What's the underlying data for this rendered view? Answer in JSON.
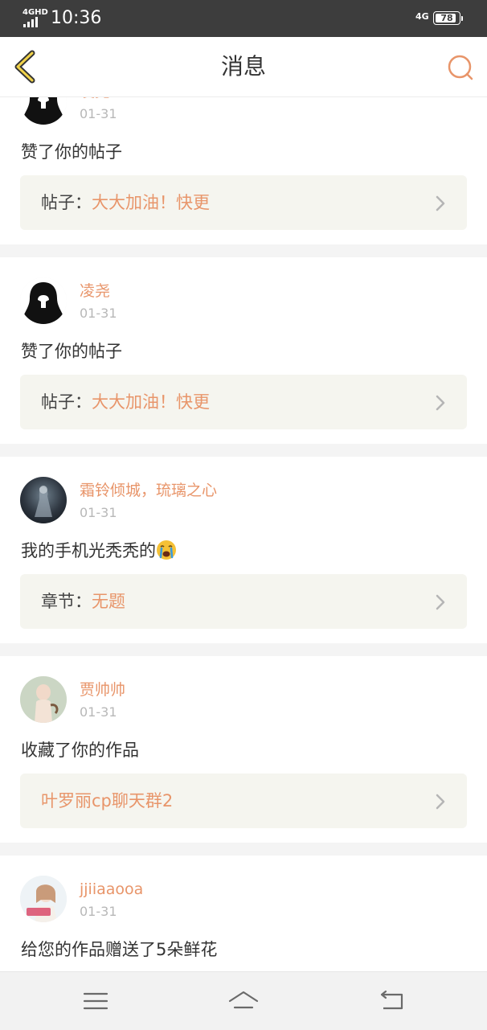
{
  "status_bar": {
    "network_label": "4GHD",
    "time": "10:36",
    "network_right": "4G",
    "battery_level": "78"
  },
  "header": {
    "title": "消息",
    "back_icon": "chevron-left-icon",
    "search_icon": "search-icon",
    "accent_color": "#e8956a"
  },
  "messages": [
    {
      "username": "凌尧",
      "date": "01-31",
      "action": "赞了你的帖子",
      "ref_prefix": "帖子：",
      "ref_title": "大大加油！快更"
    },
    {
      "username": "凌尧",
      "date": "01-31",
      "action": "赞了你的帖子",
      "ref_prefix": "帖子：",
      "ref_title": "大大加油！快更"
    },
    {
      "username": "霜铃倾城，琉璃之心",
      "date": "01-31",
      "action": "我的手机光秃秃的",
      "action_emoji": "crying-face-icon",
      "ref_prefix": "章节：",
      "ref_title": "无题"
    },
    {
      "username": "贾帅帅",
      "date": "01-31",
      "action": "收藏了你的作品",
      "ref_prefix": "",
      "ref_title": "叶罗丽cp聊天群2"
    },
    {
      "username": "jjiiaaooa",
      "date": "01-31",
      "action": "给您的作品赠送了5朵鲜花",
      "ref_prefix": "",
      "ref_title": ""
    }
  ],
  "nav_bar": {
    "menu_icon": "menu-icon",
    "home_icon": "home-icon",
    "back_icon": "back-arrow-icon"
  }
}
